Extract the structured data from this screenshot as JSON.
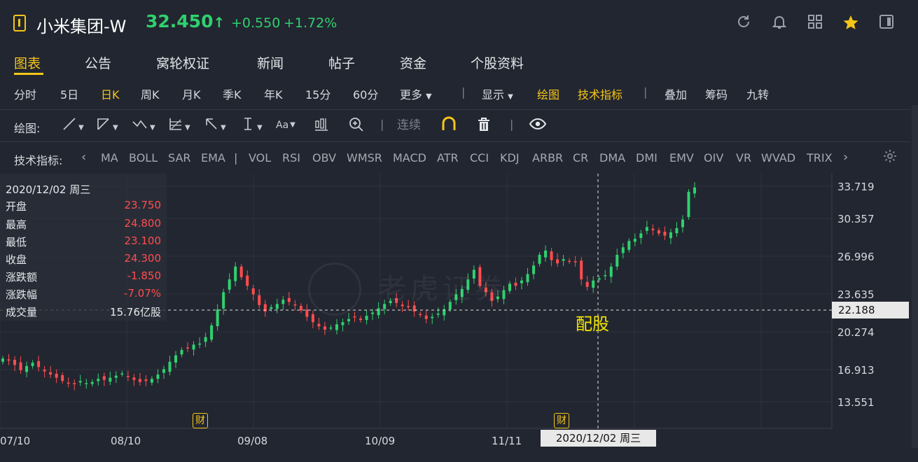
{
  "header": {
    "title": "小米集团-W",
    "price": "32.450",
    "arrow": "↑",
    "change": "+0.550",
    "change_pct": "+1.72%"
  },
  "tabs": [
    "图表",
    "公告",
    "窝轮权证",
    "新闻",
    "帖子",
    "资金",
    "个股资料"
  ],
  "period_bar": {
    "periods": [
      "分时",
      "5日",
      "日K",
      "周K",
      "月K",
      "季K",
      "年K",
      "15分",
      "60分"
    ],
    "more": "更多",
    "display": "显示",
    "draw": "绘图",
    "tech": "技术指标",
    "overlay": "叠加",
    "chips": "筹码",
    "nine": "九转"
  },
  "draw_bar": {
    "label": "绘图:",
    "continuous": "连续",
    "aa": "Aa"
  },
  "indicator_bar": {
    "label": "技术指标:",
    "items": [
      "MA",
      "BOLL",
      "SAR",
      "EMA",
      "|",
      "VOL",
      "RSI",
      "OBV",
      "WMSR",
      "MACD",
      "ATR",
      "CCI",
      "KDJ",
      "ARBR",
      "CR",
      "DMA",
      "DMI",
      "EMV",
      "OIV",
      "VR",
      "WVAD",
      "TRIX"
    ]
  },
  "ohlc_panel": {
    "date": "2020/12/02 周三",
    "rows": [
      {
        "label": "开盘",
        "value": "23.750"
      },
      {
        "label": "最高",
        "value": "24.800"
      },
      {
        "label": "最低",
        "value": "23.100"
      },
      {
        "label": "收盘",
        "value": "24.300"
      },
      {
        "label": "涨跌额",
        "value": "-1.850"
      },
      {
        "label": "涨跌幅",
        "value": "-7.07%"
      },
      {
        "label": "成交量",
        "value": "15.76亿股"
      }
    ]
  },
  "chart": {
    "y_labels": [
      "33.719",
      "30.357",
      "26.996",
      "23.635",
      "20.274",
      "16.913",
      "13.551"
    ],
    "x_labels": [
      "07/10",
      "08/10",
      "09/08",
      "10/09",
      "11/11"
    ],
    "crosshair_price": "22.188",
    "crosshair_date": "2020/12/02 周三",
    "event_marker": "财",
    "annotation": "配股",
    "watermark": "老虎证券"
  },
  "colors": {
    "up": "#2fd16e",
    "down": "#ff4d4f",
    "accent": "#f5c518",
    "background": "#222630"
  }
}
